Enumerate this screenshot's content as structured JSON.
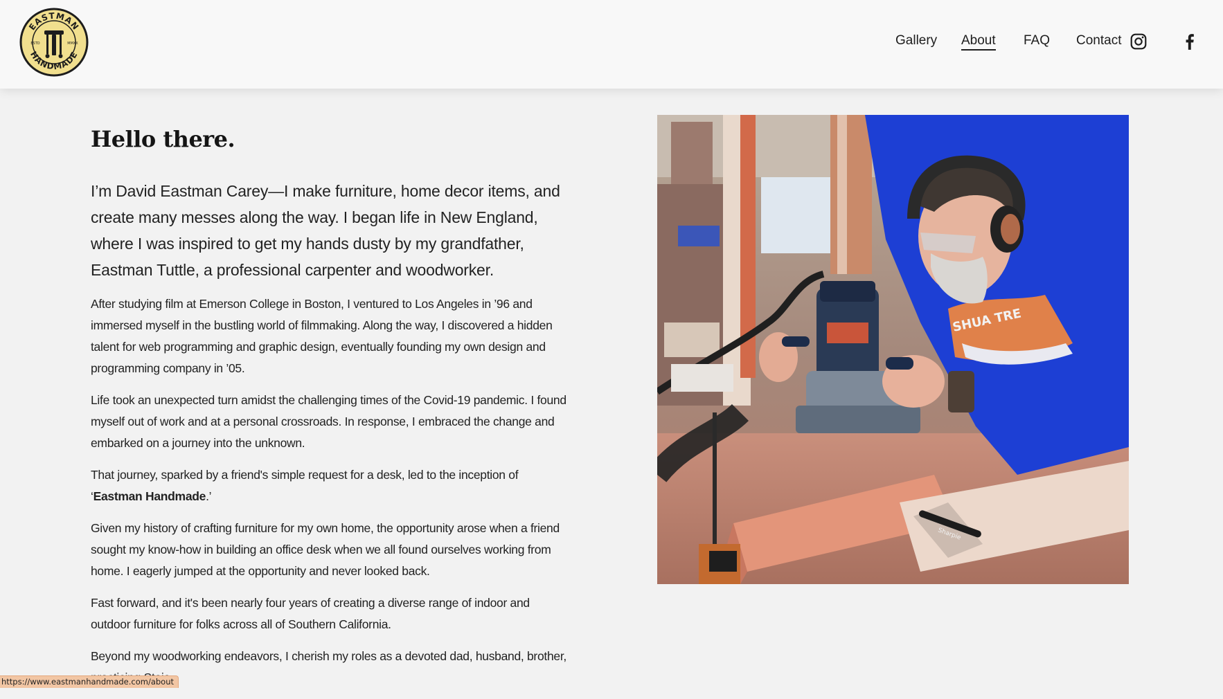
{
  "header": {
    "logo": {
      "top_text": "EASTMAN",
      "bottom_text": "HANDMADE",
      "left_text": "ESTD",
      "right_text": "MMXX",
      "colors": {
        "fill": "#f1df8e",
        "ink": "#1d1d1d"
      }
    },
    "nav": [
      {
        "label": "Gallery",
        "active": false
      },
      {
        "label": "About",
        "active": true
      },
      {
        "label": "FAQ",
        "active": false
      },
      {
        "label": "Contact",
        "active": false
      }
    ],
    "social": [
      {
        "icon": "instagram-icon"
      },
      {
        "icon": "facebook-icon"
      }
    ]
  },
  "main": {
    "title": "Hello there.",
    "lead": "I’m David Eastman Carey—I make furniture, home decor items, and create many messes along the way. I began life in New England, where I was inspired to get my hands dusty by my grandfather, Eastman Tuttle, a professional carpenter and woodworker.",
    "paragraphs": [
      "After studying film at Emerson College in Boston, I ventured to Los Angeles in ’96 and immersed myself in the bustling world of filmmaking. Along the way, I discovered a hidden talent for web programming and graphic design, eventually founding my own design and programming company in ’05.",
      "Life took an unexpected turn amidst the challenging times of the Covid-19 pandemic. I found myself out of work and at a personal crossroads. In response, I embraced the change and embarked on a journey into the unknown."
    ],
    "journey": {
      "prefix": "That journey, sparked by a friend's simple request for a desk, led to the inception of ‘",
      "brand": "Eastman Handmade",
      "suffix": ".’"
    },
    "paragraphs_after": [
      "Given my history of crafting furniture for my own home, the opportunity arose when a friend sought my know-how in building an office desk when we all found ourselves working from home.  I eagerly jumped at the opportunity and never looked back.",
      "Fast forward, and it's been nearly four years of creating a diverse range of indoor and outdoor furniture for folks across all of Southern California.",
      "Beyond my woodworking endeavors, I cherish my roles as a devoted dad, husband, brother, practicing Stoic"
    ],
    "photo": {
      "shirt_text": "SHUA TRE",
      "marker_text": "Sharpie",
      "colors": {
        "shirt": "#1d3fd4",
        "wood": "#d98a6e",
        "router": "#2a3a55"
      }
    }
  },
  "status_bar": {
    "url": "https://www.eastmanhandmade.com/about"
  }
}
